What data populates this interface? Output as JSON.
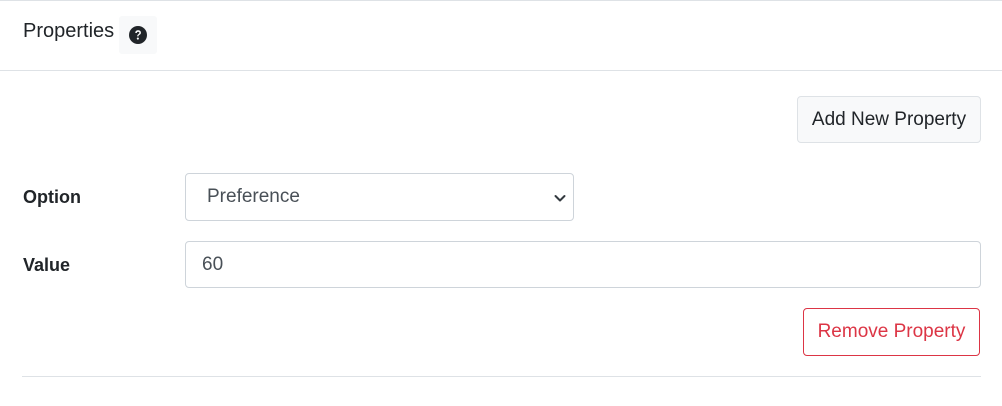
{
  "header": {
    "title": "Properties",
    "help_icon": "question-circle-icon"
  },
  "actions": {
    "add_label": "Add New Property",
    "remove_label": "Remove Property"
  },
  "property": {
    "option_label": "Option",
    "option_value": "Preference",
    "value_label": "Value",
    "value_value": "60"
  },
  "colors": {
    "danger": "#dc3545",
    "border": "#dee2e6",
    "input_border": "#ced4da",
    "light_bg": "#f8f9fa"
  }
}
